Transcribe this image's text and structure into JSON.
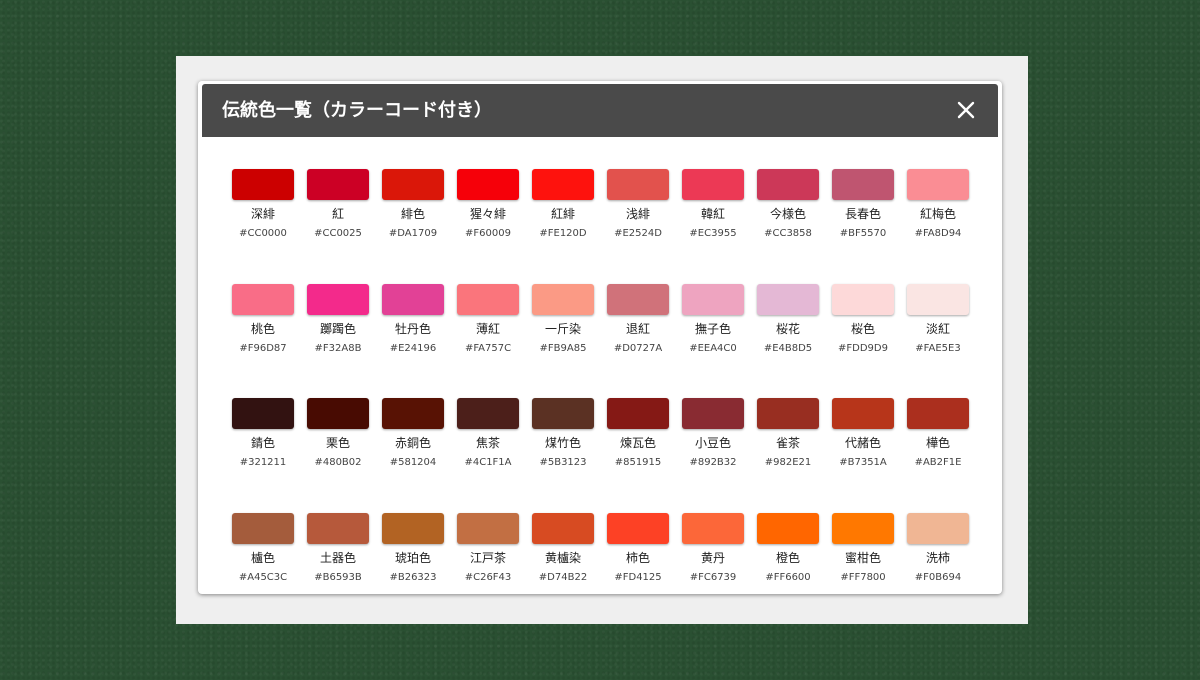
{
  "dialog": {
    "title": "伝統色一覧（カラーコード付き）",
    "close_icon": "close-icon"
  },
  "colors": [
    [
      {
        "name": "深緋",
        "code": "#CC0000"
      },
      {
        "name": "紅",
        "code": "#CC0025"
      },
      {
        "name": "緋色",
        "code": "#DA1709"
      },
      {
        "name": "猩々緋",
        "code": "#F60009"
      },
      {
        "name": "紅緋",
        "code": "#FE120D"
      },
      {
        "name": "浅緋",
        "code": "#E2524D"
      },
      {
        "name": "韓紅",
        "code": "#EC3955"
      },
      {
        "name": "今様色",
        "code": "#CC3858"
      },
      {
        "name": "長春色",
        "code": "#BF5570"
      },
      {
        "name": "紅梅色",
        "code": "#FA8D94"
      }
    ],
    [
      {
        "name": "桃色",
        "code": "#F96D87"
      },
      {
        "name": "躑躅色",
        "code": "#F32A8B"
      },
      {
        "name": "牡丹色",
        "code": "#E24196"
      },
      {
        "name": "薄紅",
        "code": "#FA757C"
      },
      {
        "name": "一斤染",
        "code": "#FB9A85"
      },
      {
        "name": "退紅",
        "code": "#D0727A"
      },
      {
        "name": "撫子色",
        "code": "#EEA4C0"
      },
      {
        "name": "桜花",
        "code": "#E4B8D5"
      },
      {
        "name": "桜色",
        "code": "#FDD9D9"
      },
      {
        "name": "淡紅",
        "code": "#FAE5E3"
      }
    ],
    [
      {
        "name": "錆色",
        "code": "#321211"
      },
      {
        "name": "栗色",
        "code": "#480B02"
      },
      {
        "name": "赤銅色",
        "code": "#581204"
      },
      {
        "name": "焦茶",
        "code": "#4C1F1A"
      },
      {
        "name": "煤竹色",
        "code": "#5B3123"
      },
      {
        "name": "煉瓦色",
        "code": "#851915"
      },
      {
        "name": "小豆色",
        "code": "#892B32"
      },
      {
        "name": "雀茶",
        "code": "#982E21"
      },
      {
        "name": "代赭色",
        "code": "#B7351A"
      },
      {
        "name": "樺色",
        "code": "#AB2F1E"
      }
    ],
    [
      {
        "name": "櫨色",
        "code": "#A45C3C"
      },
      {
        "name": "土器色",
        "code": "#B6593B"
      },
      {
        "name": "琥珀色",
        "code": "#B26323"
      },
      {
        "name": "江戸茶",
        "code": "#C26F43"
      },
      {
        "name": "黄櫨染",
        "code": "#D74B22"
      },
      {
        "name": "柿色",
        "code": "#FD4125"
      },
      {
        "name": "黄丹",
        "code": "#FC6739"
      },
      {
        "name": "橙色",
        "code": "#FF6600"
      },
      {
        "name": "蜜柑色",
        "code": "#FF7800"
      },
      {
        "name": "洗柿",
        "code": "#F0B694"
      }
    ]
  ]
}
